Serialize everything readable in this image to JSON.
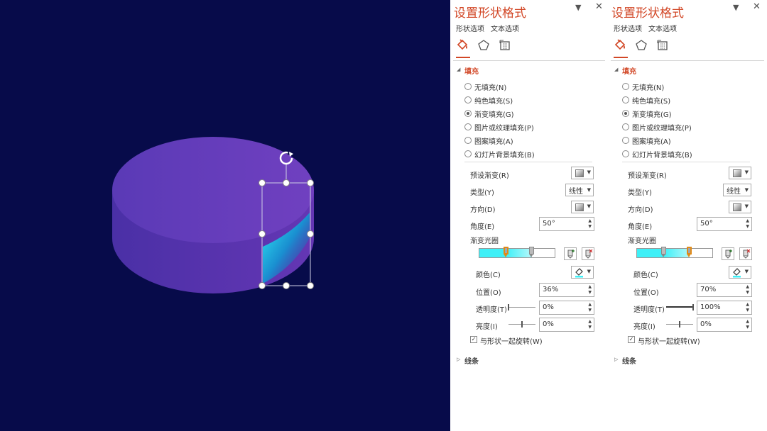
{
  "canvas": {
    "bg": "#070b4a",
    "shape_top_color": "#6c3dbb",
    "shape_side_color": "#5032a8",
    "highlight_color": "#19c7db",
    "handle_color": "#ffffff",
    "rotate_icon": "rotate-icon"
  },
  "panes": [
    {
      "title": "设置形状格式",
      "tabs": [
        {
          "label": "形状选项",
          "selected": true
        },
        {
          "label": "文本选项",
          "selected": false
        }
      ],
      "icons": [
        "fill-line-icon",
        "pentagon-icon",
        "size-properties-icon"
      ],
      "fill_section": "填充",
      "radios": [
        {
          "label": "无填充(N)",
          "checked": false
        },
        {
          "label": "纯色填充(S)",
          "checked": false
        },
        {
          "label": "渐变填充(G)",
          "checked": true
        },
        {
          "label": "图片或纹理填充(P)",
          "checked": false
        },
        {
          "label": "图案填充(A)",
          "checked": false
        },
        {
          "label": "幻灯片背景填充(B)",
          "checked": false
        }
      ],
      "preset_label": "预设渐变(R)",
      "type_label": "类型(Y)",
      "type_value": "线性",
      "direction_label": "方向(D)",
      "angle_label": "角度(E)",
      "angle_value": "50°",
      "stops_label": "渐变光圈",
      "gradient_stops": [
        {
          "position": 0.36,
          "selected": true
        },
        {
          "position": 0.7,
          "selected": false
        }
      ],
      "gradient_color": "#3ef0f7",
      "color_label": "颜色(C)",
      "position_label": "位置(O)",
      "position_value": "36%",
      "transparency_label": "透明度(T)",
      "transparency_value": "0%",
      "transparency_level": 0.0,
      "brightness_label": "亮度(I)",
      "brightness_value": "0%",
      "brightness_level": 0.5,
      "rotate_with_shape": "与形状一起旋转(W)",
      "line_section": "线条"
    },
    {
      "title": "设置形状格式",
      "tabs": [
        {
          "label": "形状选项",
          "selected": true
        },
        {
          "label": "文本选项",
          "selected": false
        }
      ],
      "icons": [
        "fill-line-icon",
        "pentagon-icon",
        "size-properties-icon"
      ],
      "fill_section": "填充",
      "radios": [
        {
          "label": "无填充(N)",
          "checked": false
        },
        {
          "label": "纯色填充(S)",
          "checked": false
        },
        {
          "label": "渐变填充(G)",
          "checked": true
        },
        {
          "label": "图片或纹理填充(P)",
          "checked": false
        },
        {
          "label": "图案填充(A)",
          "checked": false
        },
        {
          "label": "幻灯片背景填充(B)",
          "checked": false
        }
      ],
      "preset_label": "预设渐变(R)",
      "type_label": "类型(Y)",
      "type_value": "线性",
      "direction_label": "方向(D)",
      "angle_label": "角度(E)",
      "angle_value": "50°",
      "stops_label": "渐变光圈",
      "gradient_stops": [
        {
          "position": 0.36,
          "selected": false
        },
        {
          "position": 0.7,
          "selected": true
        }
      ],
      "gradient_color": "#3ef0f7",
      "color_label": "颜色(C)",
      "position_label": "位置(O)",
      "position_value": "70%",
      "transparency_label": "透明度(T)",
      "transparency_value": "100%",
      "transparency_level": 1.0,
      "brightness_label": "亮度(I)",
      "brightness_value": "0%",
      "brightness_level": 0.5,
      "rotate_with_shape": "与形状一起旋转(W)",
      "line_section": "线条"
    }
  ]
}
